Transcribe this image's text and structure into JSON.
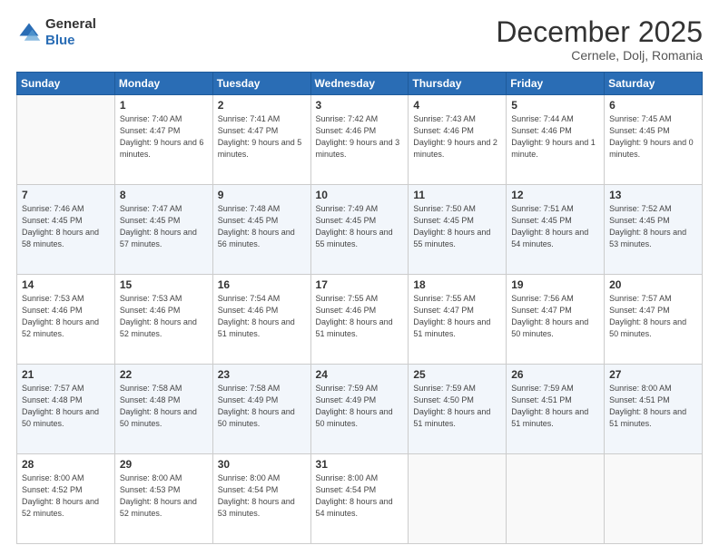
{
  "header": {
    "logo_line1": "General",
    "logo_line2": "Blue",
    "month_title": "December 2025",
    "location": "Cernele, Dolj, Romania"
  },
  "days_of_week": [
    "Sunday",
    "Monday",
    "Tuesday",
    "Wednesday",
    "Thursday",
    "Friday",
    "Saturday"
  ],
  "weeks": [
    [
      {
        "day": "",
        "sunrise": "",
        "sunset": "",
        "daylight": ""
      },
      {
        "day": "1",
        "sunrise": "Sunrise: 7:40 AM",
        "sunset": "Sunset: 4:47 PM",
        "daylight": "Daylight: 9 hours and 6 minutes."
      },
      {
        "day": "2",
        "sunrise": "Sunrise: 7:41 AM",
        "sunset": "Sunset: 4:47 PM",
        "daylight": "Daylight: 9 hours and 5 minutes."
      },
      {
        "day": "3",
        "sunrise": "Sunrise: 7:42 AM",
        "sunset": "Sunset: 4:46 PM",
        "daylight": "Daylight: 9 hours and 3 minutes."
      },
      {
        "day": "4",
        "sunrise": "Sunrise: 7:43 AM",
        "sunset": "Sunset: 4:46 PM",
        "daylight": "Daylight: 9 hours and 2 minutes."
      },
      {
        "day": "5",
        "sunrise": "Sunrise: 7:44 AM",
        "sunset": "Sunset: 4:46 PM",
        "daylight": "Daylight: 9 hours and 1 minute."
      },
      {
        "day": "6",
        "sunrise": "Sunrise: 7:45 AM",
        "sunset": "Sunset: 4:45 PM",
        "daylight": "Daylight: 9 hours and 0 minutes."
      }
    ],
    [
      {
        "day": "7",
        "sunrise": "Sunrise: 7:46 AM",
        "sunset": "Sunset: 4:45 PM",
        "daylight": "Daylight: 8 hours and 58 minutes."
      },
      {
        "day": "8",
        "sunrise": "Sunrise: 7:47 AM",
        "sunset": "Sunset: 4:45 PM",
        "daylight": "Daylight: 8 hours and 57 minutes."
      },
      {
        "day": "9",
        "sunrise": "Sunrise: 7:48 AM",
        "sunset": "Sunset: 4:45 PM",
        "daylight": "Daylight: 8 hours and 56 minutes."
      },
      {
        "day": "10",
        "sunrise": "Sunrise: 7:49 AM",
        "sunset": "Sunset: 4:45 PM",
        "daylight": "Daylight: 8 hours and 55 minutes."
      },
      {
        "day": "11",
        "sunrise": "Sunrise: 7:50 AM",
        "sunset": "Sunset: 4:45 PM",
        "daylight": "Daylight: 8 hours and 55 minutes."
      },
      {
        "day": "12",
        "sunrise": "Sunrise: 7:51 AM",
        "sunset": "Sunset: 4:45 PM",
        "daylight": "Daylight: 8 hours and 54 minutes."
      },
      {
        "day": "13",
        "sunrise": "Sunrise: 7:52 AM",
        "sunset": "Sunset: 4:45 PM",
        "daylight": "Daylight: 8 hours and 53 minutes."
      }
    ],
    [
      {
        "day": "14",
        "sunrise": "Sunrise: 7:53 AM",
        "sunset": "Sunset: 4:46 PM",
        "daylight": "Daylight: 8 hours and 52 minutes."
      },
      {
        "day": "15",
        "sunrise": "Sunrise: 7:53 AM",
        "sunset": "Sunset: 4:46 PM",
        "daylight": "Daylight: 8 hours and 52 minutes."
      },
      {
        "day": "16",
        "sunrise": "Sunrise: 7:54 AM",
        "sunset": "Sunset: 4:46 PM",
        "daylight": "Daylight: 8 hours and 51 minutes."
      },
      {
        "day": "17",
        "sunrise": "Sunrise: 7:55 AM",
        "sunset": "Sunset: 4:46 PM",
        "daylight": "Daylight: 8 hours and 51 minutes."
      },
      {
        "day": "18",
        "sunrise": "Sunrise: 7:55 AM",
        "sunset": "Sunset: 4:47 PM",
        "daylight": "Daylight: 8 hours and 51 minutes."
      },
      {
        "day": "19",
        "sunrise": "Sunrise: 7:56 AM",
        "sunset": "Sunset: 4:47 PM",
        "daylight": "Daylight: 8 hours and 50 minutes."
      },
      {
        "day": "20",
        "sunrise": "Sunrise: 7:57 AM",
        "sunset": "Sunset: 4:47 PM",
        "daylight": "Daylight: 8 hours and 50 minutes."
      }
    ],
    [
      {
        "day": "21",
        "sunrise": "Sunrise: 7:57 AM",
        "sunset": "Sunset: 4:48 PM",
        "daylight": "Daylight: 8 hours and 50 minutes."
      },
      {
        "day": "22",
        "sunrise": "Sunrise: 7:58 AM",
        "sunset": "Sunset: 4:48 PM",
        "daylight": "Daylight: 8 hours and 50 minutes."
      },
      {
        "day": "23",
        "sunrise": "Sunrise: 7:58 AM",
        "sunset": "Sunset: 4:49 PM",
        "daylight": "Daylight: 8 hours and 50 minutes."
      },
      {
        "day": "24",
        "sunrise": "Sunrise: 7:59 AM",
        "sunset": "Sunset: 4:49 PM",
        "daylight": "Daylight: 8 hours and 50 minutes."
      },
      {
        "day": "25",
        "sunrise": "Sunrise: 7:59 AM",
        "sunset": "Sunset: 4:50 PM",
        "daylight": "Daylight: 8 hours and 51 minutes."
      },
      {
        "day": "26",
        "sunrise": "Sunrise: 7:59 AM",
        "sunset": "Sunset: 4:51 PM",
        "daylight": "Daylight: 8 hours and 51 minutes."
      },
      {
        "day": "27",
        "sunrise": "Sunrise: 8:00 AM",
        "sunset": "Sunset: 4:51 PM",
        "daylight": "Daylight: 8 hours and 51 minutes."
      }
    ],
    [
      {
        "day": "28",
        "sunrise": "Sunrise: 8:00 AM",
        "sunset": "Sunset: 4:52 PM",
        "daylight": "Daylight: 8 hours and 52 minutes."
      },
      {
        "day": "29",
        "sunrise": "Sunrise: 8:00 AM",
        "sunset": "Sunset: 4:53 PM",
        "daylight": "Daylight: 8 hours and 52 minutes."
      },
      {
        "day": "30",
        "sunrise": "Sunrise: 8:00 AM",
        "sunset": "Sunset: 4:54 PM",
        "daylight": "Daylight: 8 hours and 53 minutes."
      },
      {
        "day": "31",
        "sunrise": "Sunrise: 8:00 AM",
        "sunset": "Sunset: 4:54 PM",
        "daylight": "Daylight: 8 hours and 54 minutes."
      },
      {
        "day": "",
        "sunrise": "",
        "sunset": "",
        "daylight": ""
      },
      {
        "day": "",
        "sunrise": "",
        "sunset": "",
        "daylight": ""
      },
      {
        "day": "",
        "sunrise": "",
        "sunset": "",
        "daylight": ""
      }
    ]
  ]
}
